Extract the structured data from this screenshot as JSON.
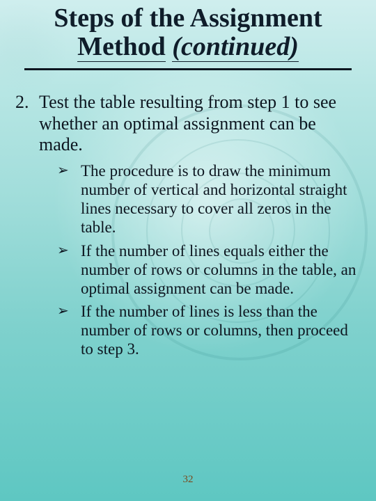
{
  "title": {
    "line1": "Steps of the Assignment",
    "line2_underlined": "Method",
    "line2_continued": "(continued)"
  },
  "step": {
    "number": "2.",
    "text": "Test the table resulting from step 1 to see whether an optimal assignment can be made."
  },
  "bullets": [
    "The procedure is to draw the minimum number of vertical and horizontal straight lines necessary to cover all zeros in the table.",
    "If the number of lines equals either the number of rows or columns in the table, an optimal assignment can be made.",
    "If the number of lines is less than the number of rows or columns, then proceed to step 3."
  ],
  "arrow_glyph": "➢",
  "page_number": "32"
}
